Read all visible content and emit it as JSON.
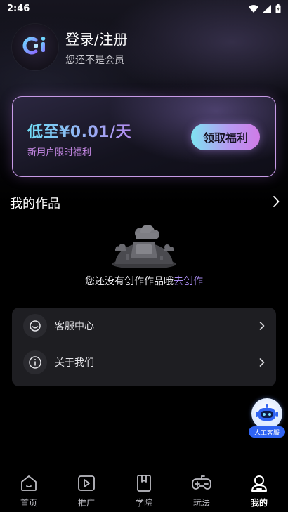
{
  "status_bar": {
    "time": "2:46",
    "icons": [
      "wifi-icon",
      "signal-icon",
      "battery-icon"
    ]
  },
  "profile": {
    "title": "登录/注册",
    "subtitle": "您还不是会员",
    "avatar_icon": "app-logo-icon"
  },
  "promo": {
    "price": "低至¥0.01/天",
    "subtitle": "新用户限时福利",
    "button_label": "领取福利",
    "border_color": "#c79ae6"
  },
  "works": {
    "title": "我的作品",
    "empty_text": "您还没有创作作品哦",
    "empty_link": "去创作"
  },
  "menu": {
    "items": [
      {
        "label": "客服中心",
        "icon": "headset-smile-icon"
      },
      {
        "label": "关于我们",
        "icon": "info-icon"
      }
    ]
  },
  "floating_service": {
    "label": "人工客服",
    "icon": "robot-icon"
  },
  "bottom_nav": {
    "items": [
      {
        "label": "首页",
        "icon": "home-icon",
        "active": false
      },
      {
        "label": "推广",
        "icon": "play-icon",
        "active": false
      },
      {
        "label": "学院",
        "icon": "book-icon",
        "active": false
      },
      {
        "label": "玩法",
        "icon": "gamepad-icon",
        "active": false
      },
      {
        "label": "我的",
        "icon": "user-icon",
        "active": true
      }
    ]
  },
  "colors": {
    "accent_gradient_start": "#7fe3f2",
    "accent_gradient_end": "#d07be6",
    "link_color": "#a98cf0",
    "service_badge": "#2f63f2"
  }
}
